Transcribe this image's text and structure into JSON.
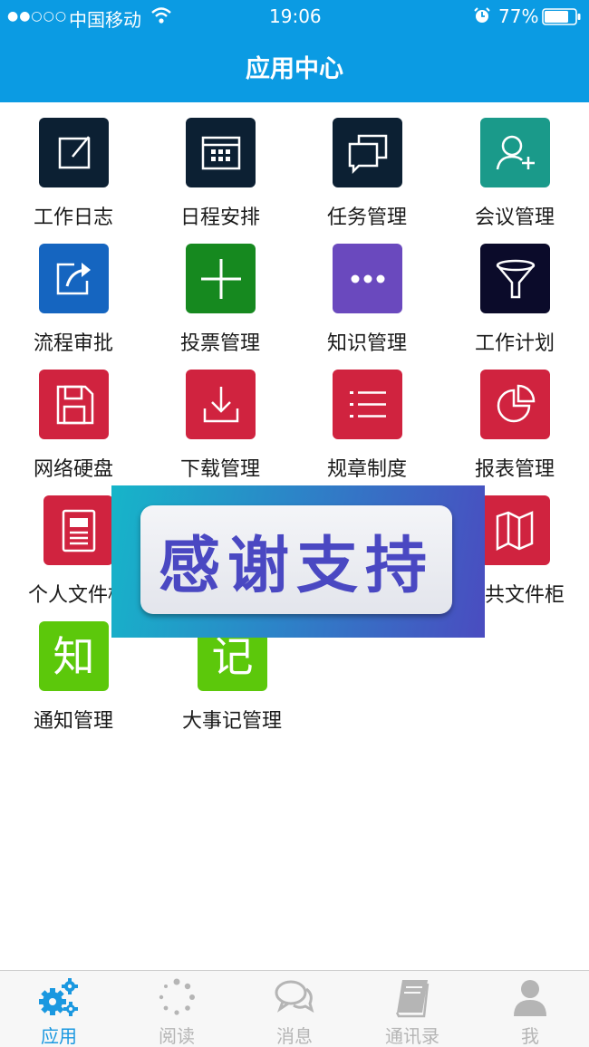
{
  "status_bar": {
    "signal": "●●○○○",
    "carrier": "中国移动",
    "time": "19:06",
    "battery": "77%"
  },
  "header": {
    "title": "应用中心"
  },
  "apps": [
    {
      "label": "工作日志",
      "color": "#0c2033",
      "icon": "edit-icon"
    },
    {
      "label": "日程安排",
      "color": "#0c2033",
      "icon": "calendar-icon"
    },
    {
      "label": "任务管理",
      "color": "#0c2033",
      "icon": "windows-stack-icon"
    },
    {
      "label": "会议管理",
      "color": "#1a9a8a",
      "icon": "add-person-icon"
    },
    {
      "label": "流程审批",
      "color": "#1565c0",
      "icon": "share-icon"
    },
    {
      "label": "投票管理",
      "color": "#16891f",
      "icon": "plus-icon"
    },
    {
      "label": "知识管理",
      "color": "#6a49be",
      "icon": "more-dots-icon"
    },
    {
      "label": "工作计划",
      "color": "#0b0b2a",
      "icon": "funnel-icon"
    },
    {
      "label": "网络硬盘",
      "color": "#d0233f",
      "icon": "floppy-disk-icon"
    },
    {
      "label": "下载管理",
      "color": "#d0233f",
      "icon": "download-icon"
    },
    {
      "label": "规章制度",
      "color": "#d0233f",
      "icon": "list-icon"
    },
    {
      "label": "报表管理",
      "color": "#d0233f",
      "icon": "pie-chart-icon"
    },
    {
      "label": "个人文件柜",
      "color": "#d0233f",
      "icon": "document-icon"
    },
    {
      "label": "公共文件柜",
      "color": "#d0233f",
      "icon": "map-icon"
    },
    {
      "label": "通知管理",
      "color": "#5cc80b",
      "icon": "zhi-glyph-icon",
      "glyph": "知"
    },
    {
      "label": "大事记管理",
      "color": "#5cc80b",
      "icon": "ji-glyph-icon",
      "glyph": "记"
    }
  ],
  "banner": {
    "text": "感谢支持"
  },
  "tabs": [
    {
      "label": "应用",
      "icon": "gears-icon",
      "active": true
    },
    {
      "label": "阅读",
      "icon": "loading-dots-icon",
      "active": false
    },
    {
      "label": "消息",
      "icon": "chat-bubbles-icon",
      "active": false
    },
    {
      "label": "通讯录",
      "icon": "address-book-icon",
      "active": false
    },
    {
      "label": "我",
      "icon": "user-icon",
      "active": false
    }
  ],
  "colors": {
    "primary": "#0b9be3",
    "tab_active": "#1a98e0",
    "tab_inactive": "#b5b5b5"
  }
}
